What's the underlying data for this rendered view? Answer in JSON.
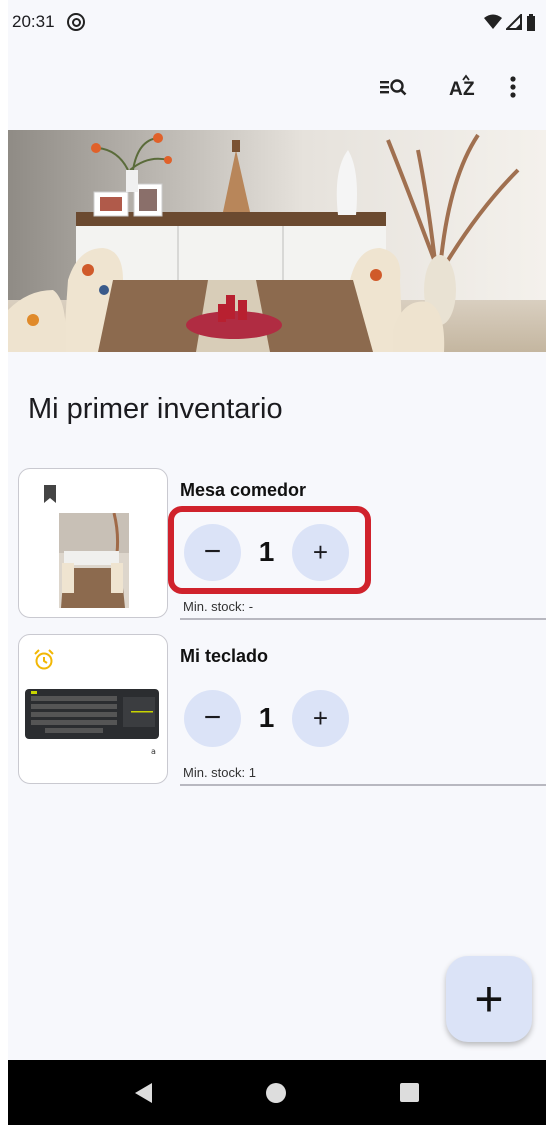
{
  "status_bar": {
    "time": "20:31"
  },
  "app_bar": {
    "filter_icon_label": "≡Q",
    "sort_icon_label": "AZ",
    "menu_icon": "more-vert-icon"
  },
  "page": {
    "title": "Mi primer inventario"
  },
  "items": [
    {
      "name": "Mesa comedor",
      "quantity": "1",
      "min_stock": "Min. stock: -",
      "badge_icon": "bookmark-icon",
      "minus_label": "−",
      "plus_label": "+"
    },
    {
      "name": "Mi teclado",
      "quantity": "1",
      "min_stock": "Min. stock: 1",
      "badge_icon": "alarm-clock-icon",
      "minus_label": "−",
      "plus_label": "+"
    }
  ],
  "fab": {
    "label": "+"
  },
  "colors": {
    "accent": "#dbe3f7",
    "highlight": "#d0222c",
    "alarm": "#f2b705"
  }
}
